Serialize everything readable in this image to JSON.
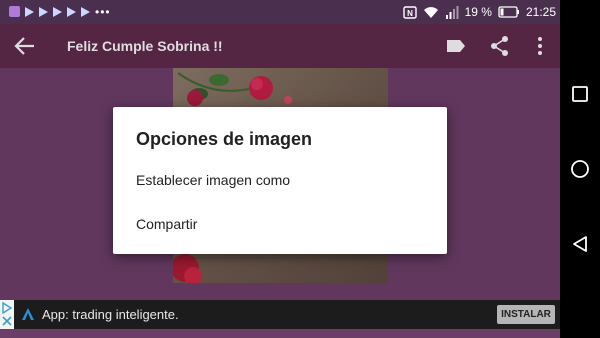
{
  "status_bar": {
    "battery_percent": "19 %",
    "time": "21:25",
    "overflow_dots": "•••",
    "notification_icons": [
      "app-notification-icon",
      "flag-icon",
      "flag-icon",
      "flag-icon",
      "flag-icon",
      "flag-icon"
    ]
  },
  "app_bar": {
    "title": "Feliz Cumple Sobrina !!",
    "icons": [
      "back-arrow-icon",
      "label-icon",
      "share-icon",
      "more-vert-icon"
    ]
  },
  "dialog": {
    "title": "Opciones de imagen",
    "options": [
      "Establecer imagen como",
      "Compartir"
    ]
  },
  "ad": {
    "text": "App: trading inteligente.",
    "install_label": "INSTALAR"
  },
  "nav_bar": {
    "icons": [
      "recents-square-icon",
      "home-circle-icon",
      "back-triangle-icon"
    ]
  },
  "colors": {
    "background": "#6b3e68",
    "app_bar": "#5c2a48",
    "status_bar": "#4a2f4e",
    "ad_bar": "#1c1c1c",
    "install_button": "#b5b5b5"
  }
}
